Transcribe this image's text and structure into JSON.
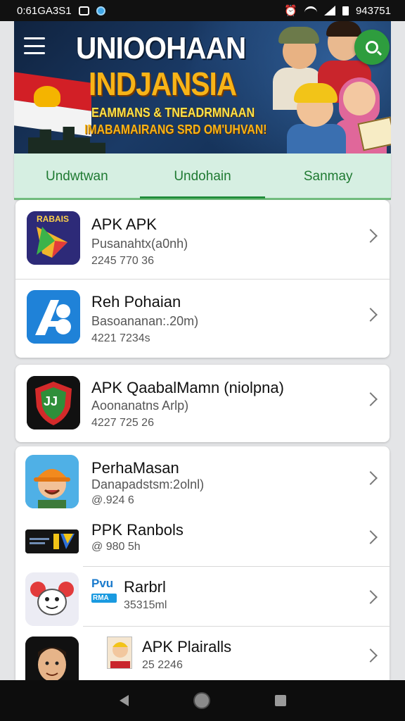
{
  "status_bar": {
    "left_text": "0:61GA3S1",
    "right_text": "943751",
    "icons": [
      "camera-icon",
      "location-icon",
      "alarm-icon",
      "wifi-icon",
      "signal-icon",
      "battery-icon"
    ]
  },
  "banner": {
    "title_line1": "UNIOOHAAN",
    "title_line2": "INDJANSIA",
    "subtitle_line1": "EAMMANS & TNEADRMNAAN",
    "subtitle_line2": "IMABAMAIRANG SRD OM'UHVAN!"
  },
  "tabs": [
    {
      "label": "Undwtwan",
      "active": false
    },
    {
      "label": "Undohain",
      "active": true
    },
    {
      "label": "Sanmay",
      "active": false
    }
  ],
  "apps_group1": [
    {
      "title": "APK APK",
      "subtitle": "Pusanahtx(a0nh)",
      "meta": "2245 770 36",
      "icon": "play-store-icon",
      "icon_label": "RABAIS"
    },
    {
      "title": "Reh Pohaian",
      "subtitle": "Basoananan:.20m)",
      "meta": "4221 7234s",
      "icon": "letter-a-app-icon"
    }
  ],
  "apps_group2": [
    {
      "title": "APK QaabalMamn (niolpna)",
      "subtitle": "Aoonanatns Arlp)",
      "meta": "4227 725 26",
      "icon": "shield-app-icon",
      "icon_label": "JJ"
    }
  ],
  "apps_group3": [
    {
      "title": "PerhaMasan",
      "subtitle": "Danapadstsm:2olnl)",
      "meta": "@.924 6",
      "icon": "worker-cartoon-icon"
    },
    {
      "title": "PPK Ranbols",
      "subtitle": "",
      "meta": "@ 980 5h",
      "icon": "dark-banner-app-icon"
    },
    {
      "title": "Rarbrl",
      "subtitle": "",
      "meta": "35315ml",
      "icon": "character-app-icon",
      "badge_top": "Pvu",
      "badge_bottom": "RMA"
    },
    {
      "title": "APK Plairalls",
      "subtitle": "",
      "meta": "25 2246",
      "icon": "portrait-app-icon"
    }
  ],
  "nav": {
    "icons": [
      "back-icon",
      "home-icon",
      "recents-icon"
    ]
  },
  "colors": {
    "accent_green": "#2e9d3e",
    "tab_bg": "#d6efe2",
    "tab_text": "#1f7a32"
  }
}
